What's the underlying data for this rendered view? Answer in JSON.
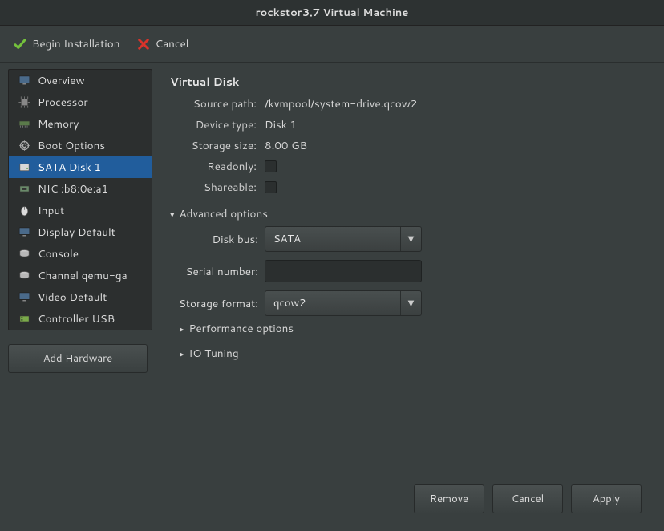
{
  "titlebar": {
    "title": "rockstor3.7 Virtual Machine"
  },
  "toolbar": {
    "begin_install": "Begin Installation",
    "cancel": "Cancel"
  },
  "sidebar": {
    "items": [
      {
        "label": "Overview",
        "icon": "monitor-icon"
      },
      {
        "label": "Processor",
        "icon": "cpu-icon"
      },
      {
        "label": "Memory",
        "icon": "memory-icon"
      },
      {
        "label": "Boot Options",
        "icon": "boot-icon"
      },
      {
        "label": "SATA Disk 1",
        "icon": "disk-icon"
      },
      {
        "label": "NIC :b8:0e:a1",
        "icon": "nic-icon"
      },
      {
        "label": "Input",
        "icon": "mouse-icon"
      },
      {
        "label": "Display Default",
        "icon": "display-icon"
      },
      {
        "label": "Console",
        "icon": "console-icon"
      },
      {
        "label": "Channel qemu-ga",
        "icon": "channel-icon"
      },
      {
        "label": "Video Default",
        "icon": "video-icon"
      },
      {
        "label": "Controller USB",
        "icon": "usb-icon"
      }
    ],
    "selected_index": 4,
    "add_hardware": "Add Hardware"
  },
  "disk": {
    "heading": "Virtual Disk",
    "labels": {
      "source_path": "Source path:",
      "device_type": "Device type:",
      "storage_size": "Storage size:",
      "readonly": "Readonly:",
      "shareable": "Shareable:"
    },
    "source_path": "/kvmpool/system-drive.qcow2",
    "device_type": "Disk 1",
    "storage_size": "8.00 GB",
    "readonly": false,
    "shareable": false,
    "advanced": {
      "header": "Advanced options",
      "labels": {
        "disk_bus": "Disk bus:",
        "serial_number": "Serial number:",
        "storage_format": "Storage format:"
      },
      "disk_bus": "SATA",
      "serial_number": "",
      "storage_format": "qcow2",
      "performance": "Performance options",
      "io_tuning": "IO Tuning"
    }
  },
  "footer": {
    "remove": "Remove",
    "cancel": "Cancel",
    "apply": "Apply"
  }
}
